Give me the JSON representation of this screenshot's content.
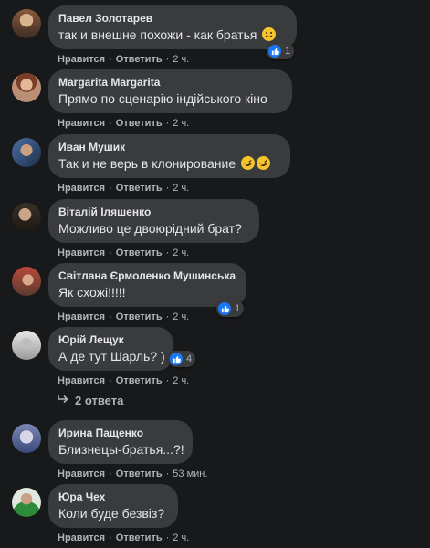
{
  "comments": [
    {
      "author": "Павел Золотарев",
      "text": "так и внешне похожи - как братья",
      "emoji": "smile",
      "reaction_count": "1",
      "like": "Нравится",
      "reply": "Ответить",
      "time": "2 ч."
    },
    {
      "author": "Margarita Margarita",
      "text": "Прямо по сценарію індійського кіно",
      "like": "Нравится",
      "reply": "Ответить",
      "time": "2 ч."
    },
    {
      "author": "Иван Мушик",
      "text": "Так и не верь в клонирование",
      "emoji": "rofl",
      "like": "Нравится",
      "reply": "Ответить",
      "time": "2 ч."
    },
    {
      "author": "Віталій Іляшенко",
      "text": "Можливо це двоюрідний брат?",
      "like": "Нравится",
      "reply": "Ответить",
      "time": "2 ч."
    },
    {
      "author": "Світлана Єрмоленко Мушинська",
      "text": "Як схожі!!!!!",
      "reaction_count": "1",
      "like": "Нравится",
      "reply": "Ответить",
      "time": "2 ч."
    },
    {
      "author": "Юрій Лещук",
      "text": "А де тут Шарль? )",
      "reaction_count": "4",
      "like": "Нравится",
      "reply": "Ответить",
      "time": "2 ч."
    },
    {
      "author": "Ирина Пащенко",
      "text": "Близнецы-братья...?!",
      "like": "Нравится",
      "reply": "Ответить",
      "time": "53 мин."
    },
    {
      "author": "Юра Чех",
      "text": "Коли буде безвіз?",
      "like": "Нравится",
      "reply": "Ответить",
      "time": "2 ч."
    }
  ],
  "replies_link": "2 ответа",
  "separator": "·",
  "colors": {
    "background": "#18191a",
    "bubble": "#3a3b3c",
    "text": "#e4e6eb",
    "secondary": "#b0b3b8",
    "like_blue": "#1877f2"
  }
}
